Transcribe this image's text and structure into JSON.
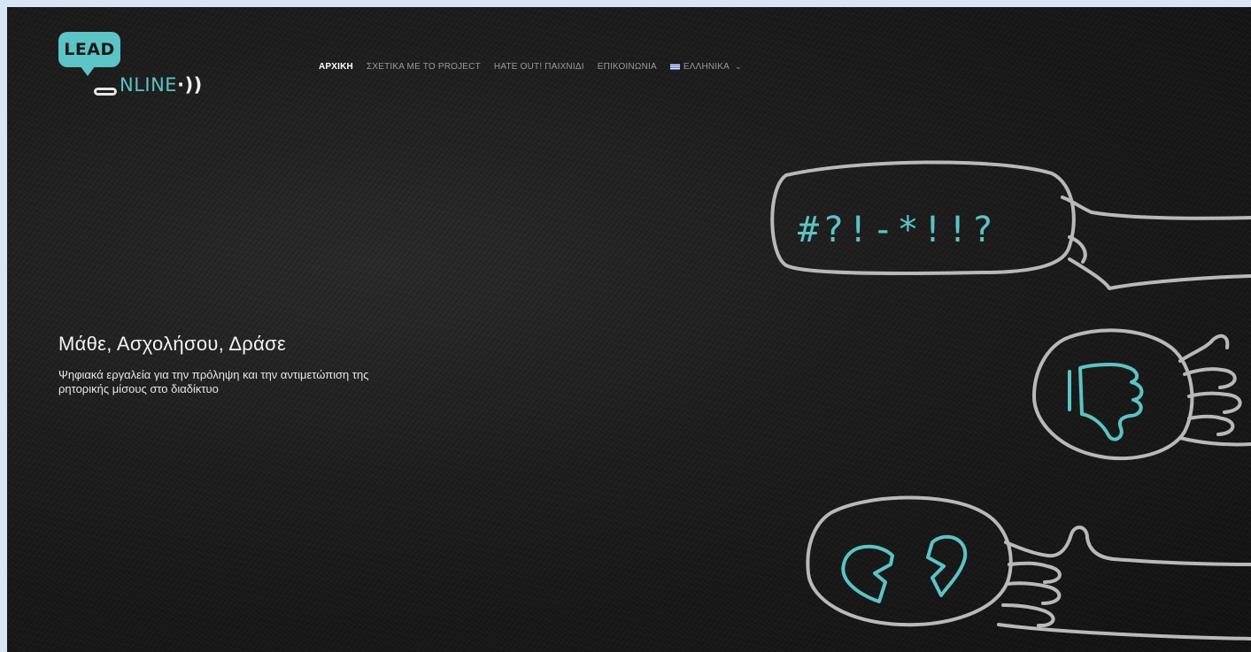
{
  "logo": {
    "top_text": "LEAD",
    "bottom_o": "O",
    "bottom_text": "NLINE",
    "sound_glyph": "·))"
  },
  "nav": {
    "items": [
      {
        "label": "ΑΡΧΙΚΗ",
        "active": true
      },
      {
        "label": "ΣΧΕΤΙΚΑ ΜΕ ΤΟ PROJECT",
        "active": false
      },
      {
        "label": "HATE OUT! ΠΑΙΧΝΙΔΙ",
        "active": false
      },
      {
        "label": "ΕΠΙΚΟΙΝΩΝΙΑ",
        "active": false
      }
    ],
    "language": {
      "label": "ΕΛΛΗΝΙΚΑ",
      "chevron": "⌄"
    }
  },
  "hero": {
    "title": "Μάθε, Ασχολήσου, Δράσε",
    "subtitle": "Ψηφιακά εργαλεία για την πρόληψη και την αντιμετώπιση της ρητορικής μίσους στο διαδίκτυο"
  },
  "illustration": {
    "speech_text": "#?!-*!!?",
    "icons": [
      "thumbs-down-icon",
      "broken-heart-icon"
    ]
  },
  "colors": {
    "accent": "#5cc3c6",
    "background": "#1a1a1a",
    "stroke": "#b9b9b9"
  }
}
